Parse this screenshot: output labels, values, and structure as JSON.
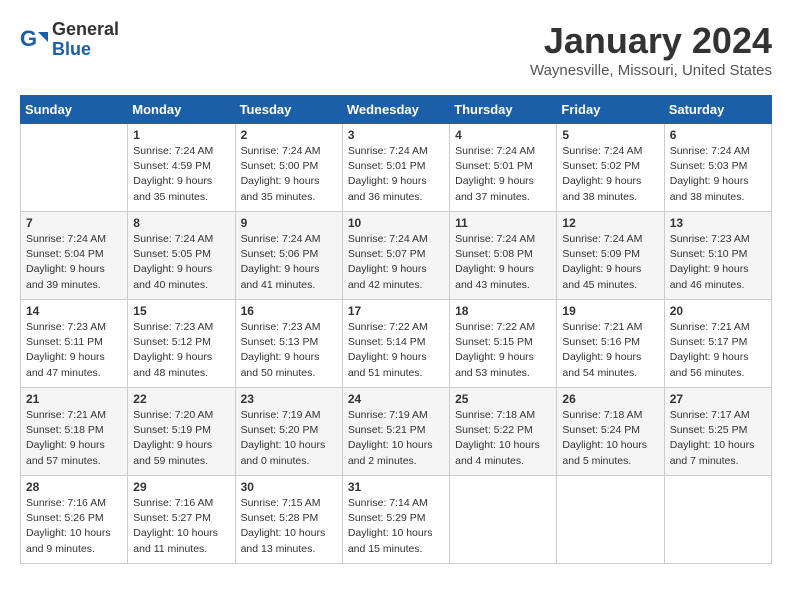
{
  "logo": {
    "line1": "General",
    "line2": "Blue"
  },
  "title": "January 2024",
  "location": "Waynesville, Missouri, United States",
  "weekdays": [
    "Sunday",
    "Monday",
    "Tuesday",
    "Wednesday",
    "Thursday",
    "Friday",
    "Saturday"
  ],
  "weeks": [
    [
      {
        "day": "",
        "info": ""
      },
      {
        "day": "1",
        "info": "Sunrise: 7:24 AM\nSunset: 4:59 PM\nDaylight: 9 hours\nand 35 minutes."
      },
      {
        "day": "2",
        "info": "Sunrise: 7:24 AM\nSunset: 5:00 PM\nDaylight: 9 hours\nand 35 minutes."
      },
      {
        "day": "3",
        "info": "Sunrise: 7:24 AM\nSunset: 5:01 PM\nDaylight: 9 hours\nand 36 minutes."
      },
      {
        "day": "4",
        "info": "Sunrise: 7:24 AM\nSunset: 5:01 PM\nDaylight: 9 hours\nand 37 minutes."
      },
      {
        "day": "5",
        "info": "Sunrise: 7:24 AM\nSunset: 5:02 PM\nDaylight: 9 hours\nand 38 minutes."
      },
      {
        "day": "6",
        "info": "Sunrise: 7:24 AM\nSunset: 5:03 PM\nDaylight: 9 hours\nand 38 minutes."
      }
    ],
    [
      {
        "day": "7",
        "info": "Sunrise: 7:24 AM\nSunset: 5:04 PM\nDaylight: 9 hours\nand 39 minutes."
      },
      {
        "day": "8",
        "info": "Sunrise: 7:24 AM\nSunset: 5:05 PM\nDaylight: 9 hours\nand 40 minutes."
      },
      {
        "day": "9",
        "info": "Sunrise: 7:24 AM\nSunset: 5:06 PM\nDaylight: 9 hours\nand 41 minutes."
      },
      {
        "day": "10",
        "info": "Sunrise: 7:24 AM\nSunset: 5:07 PM\nDaylight: 9 hours\nand 42 minutes."
      },
      {
        "day": "11",
        "info": "Sunrise: 7:24 AM\nSunset: 5:08 PM\nDaylight: 9 hours\nand 43 minutes."
      },
      {
        "day": "12",
        "info": "Sunrise: 7:24 AM\nSunset: 5:09 PM\nDaylight: 9 hours\nand 45 minutes."
      },
      {
        "day": "13",
        "info": "Sunrise: 7:23 AM\nSunset: 5:10 PM\nDaylight: 9 hours\nand 46 minutes."
      }
    ],
    [
      {
        "day": "14",
        "info": "Sunrise: 7:23 AM\nSunset: 5:11 PM\nDaylight: 9 hours\nand 47 minutes."
      },
      {
        "day": "15",
        "info": "Sunrise: 7:23 AM\nSunset: 5:12 PM\nDaylight: 9 hours\nand 48 minutes."
      },
      {
        "day": "16",
        "info": "Sunrise: 7:23 AM\nSunset: 5:13 PM\nDaylight: 9 hours\nand 50 minutes."
      },
      {
        "day": "17",
        "info": "Sunrise: 7:22 AM\nSunset: 5:14 PM\nDaylight: 9 hours\nand 51 minutes."
      },
      {
        "day": "18",
        "info": "Sunrise: 7:22 AM\nSunset: 5:15 PM\nDaylight: 9 hours\nand 53 minutes."
      },
      {
        "day": "19",
        "info": "Sunrise: 7:21 AM\nSunset: 5:16 PM\nDaylight: 9 hours\nand 54 minutes."
      },
      {
        "day": "20",
        "info": "Sunrise: 7:21 AM\nSunset: 5:17 PM\nDaylight: 9 hours\nand 56 minutes."
      }
    ],
    [
      {
        "day": "21",
        "info": "Sunrise: 7:21 AM\nSunset: 5:18 PM\nDaylight: 9 hours\nand 57 minutes."
      },
      {
        "day": "22",
        "info": "Sunrise: 7:20 AM\nSunset: 5:19 PM\nDaylight: 9 hours\nand 59 minutes."
      },
      {
        "day": "23",
        "info": "Sunrise: 7:19 AM\nSunset: 5:20 PM\nDaylight: 10 hours\nand 0 minutes."
      },
      {
        "day": "24",
        "info": "Sunrise: 7:19 AM\nSunset: 5:21 PM\nDaylight: 10 hours\nand 2 minutes."
      },
      {
        "day": "25",
        "info": "Sunrise: 7:18 AM\nSunset: 5:22 PM\nDaylight: 10 hours\nand 4 minutes."
      },
      {
        "day": "26",
        "info": "Sunrise: 7:18 AM\nSunset: 5:24 PM\nDaylight: 10 hours\nand 5 minutes."
      },
      {
        "day": "27",
        "info": "Sunrise: 7:17 AM\nSunset: 5:25 PM\nDaylight: 10 hours\nand 7 minutes."
      }
    ],
    [
      {
        "day": "28",
        "info": "Sunrise: 7:16 AM\nSunset: 5:26 PM\nDaylight: 10 hours\nand 9 minutes."
      },
      {
        "day": "29",
        "info": "Sunrise: 7:16 AM\nSunset: 5:27 PM\nDaylight: 10 hours\nand 11 minutes."
      },
      {
        "day": "30",
        "info": "Sunrise: 7:15 AM\nSunset: 5:28 PM\nDaylight: 10 hours\nand 13 minutes."
      },
      {
        "day": "31",
        "info": "Sunrise: 7:14 AM\nSunset: 5:29 PM\nDaylight: 10 hours\nand 15 minutes."
      },
      {
        "day": "",
        "info": ""
      },
      {
        "day": "",
        "info": ""
      },
      {
        "day": "",
        "info": ""
      }
    ]
  ]
}
